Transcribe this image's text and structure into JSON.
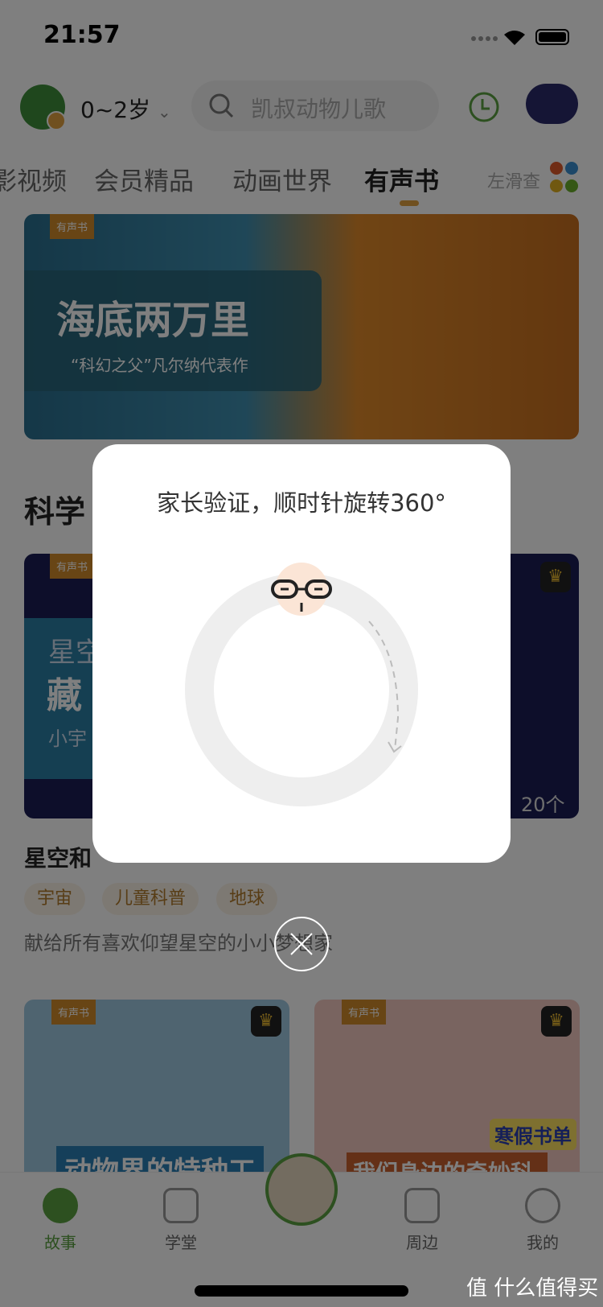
{
  "status_bar": {
    "time": "21:57"
  },
  "header": {
    "age_selector": "0~2岁",
    "search_placeholder": "凯叔动物儿歌"
  },
  "tabs": [
    {
      "label": "影视频"
    },
    {
      "label": "会员精品"
    },
    {
      "label": "动画世界"
    },
    {
      "label": "有声书",
      "active": true
    },
    {
      "label": "左滑查"
    }
  ],
  "banner": {
    "badge": "有声书",
    "title": "海底两万里",
    "subtitle": "“科幻之父”凡尔纳代表作"
  },
  "section": {
    "title": "科学"
  },
  "featured": {
    "badge": "有声书",
    "cover_title_1": "星空",
    "cover_title_2": "藏",
    "cover_sub": "小宇",
    "count": "20个",
    "title": "星空和",
    "tags": [
      "宇宙",
      "儿童科普",
      "地球"
    ],
    "description": "献给所有喜欢仰望星空的小小梦想家"
  },
  "cards": [
    {
      "badge": "有声书",
      "cover_title": "动物界的特种工"
    },
    {
      "badge": "有声书",
      "cover_title": "我们身边的奇妙科学",
      "sticker": "寒假书单"
    }
  ],
  "tabbar": [
    {
      "label": "故事",
      "active": true,
      "icon": "planet-icon"
    },
    {
      "label": "学堂",
      "icon": "play-book-icon"
    },
    {
      "label": "周边",
      "icon": "shop-icon"
    },
    {
      "label": "我的",
      "icon": "face-icon"
    }
  ],
  "dialog": {
    "title": "家长验证，顺时针旋转360°"
  },
  "watermark": "值 什么值得买",
  "colors": {
    "accent": "#5aa040",
    "tab_indicator": "#e0a040"
  }
}
